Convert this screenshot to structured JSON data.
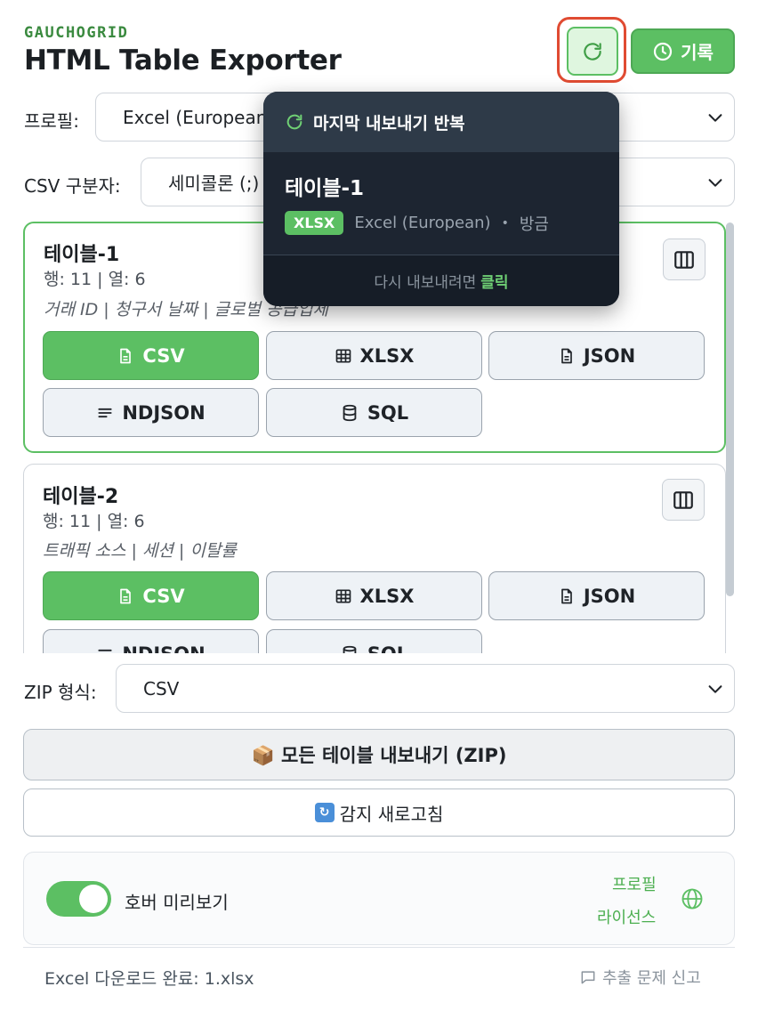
{
  "header": {
    "brand": "GAUCHOGRID",
    "title": "HTML Table Exporter",
    "history_label": "기록"
  },
  "profile": {
    "label": "프로필:",
    "value": "Excel (European)"
  },
  "csv_delimiter": {
    "label": "CSV 구분자:",
    "value": "세미콜론 (;)"
  },
  "tables": [
    {
      "name": "테이블-1",
      "meta": "행: 11 | 열: 6",
      "columns": "거래 ID | 청구서 날짜 | 글로벌 공급업체",
      "formats": [
        "CSV",
        "XLSX",
        "JSON",
        "NDJSON",
        "SQL"
      ]
    },
    {
      "name": "테이블-2",
      "meta": "행: 11 | 열: 6",
      "columns": "트래픽 소스 | 세션 | 이탈률",
      "formats": [
        "CSV",
        "XLSX",
        "JSON",
        "NDJSON",
        "SQL"
      ]
    }
  ],
  "zip": {
    "label": "ZIP 형식:",
    "value": "CSV",
    "export_all_label": "📦 모든 테이블 내보내기 (ZIP)"
  },
  "refresh_label": "감지 새로고침",
  "settings": {
    "hover_preview_label": "호버 미리보기",
    "hover_preview_enabled": true,
    "profile_link": "프로필",
    "license_link": "라이선스"
  },
  "footer": {
    "status": "Excel 다운로드 완료: 1.xlsx",
    "report_label": "추출 문제 신고"
  },
  "tooltip": {
    "title": "마지막 내보내기 반복",
    "table_name": "테이블-1",
    "format_badge": "XLSX",
    "profile": "Excel (European)",
    "time": "방금",
    "hint_prefix": "다시 내보내려면",
    "hint_action": "클릭"
  },
  "colors": {
    "accent_green": "#5cbf63",
    "highlight_red": "#e04b32",
    "tooltip_bg": "#1d2531"
  }
}
